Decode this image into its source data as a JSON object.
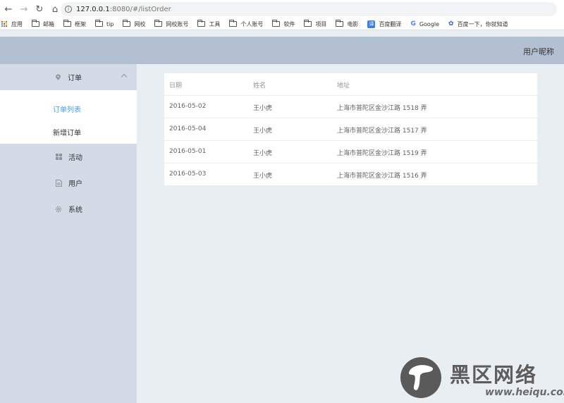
{
  "browser": {
    "url_host": "127.0.0.1",
    "url_rest": ":8080/#/listOrder",
    "bookmarks": [
      {
        "label": "应用",
        "icon": "apps-icon"
      },
      {
        "label": "邮箱",
        "icon": "folder-icon"
      },
      {
        "label": "框架",
        "icon": "folder-icon"
      },
      {
        "label": "tip",
        "icon": "folder-icon"
      },
      {
        "label": "网校",
        "icon": "folder-icon"
      },
      {
        "label": "网校账号",
        "icon": "folder-icon"
      },
      {
        "label": "工具",
        "icon": "folder-icon"
      },
      {
        "label": "个人账号",
        "icon": "folder-icon"
      },
      {
        "label": "软件",
        "icon": "folder-icon"
      },
      {
        "label": "项目",
        "icon": "folder-icon"
      },
      {
        "label": "电影",
        "icon": "folder-icon"
      },
      {
        "label": "百度翻译",
        "icon": "fanyi-icon"
      },
      {
        "label": "Google",
        "icon": "google-icon"
      },
      {
        "label": "百度一下，你就知道",
        "icon": "baidu-icon"
      }
    ]
  },
  "header": {
    "user_name": "用户昵称"
  },
  "sidebar": {
    "order_menu": {
      "label": "订单",
      "icon": "location-pin-icon",
      "items": [
        {
          "label": "订单列表",
          "active": true
        },
        {
          "label": "新增订单",
          "active": false
        }
      ]
    },
    "items": [
      {
        "label": "活动",
        "icon": "grid-icon"
      },
      {
        "label": "用户",
        "icon": "document-icon"
      },
      {
        "label": "系统",
        "icon": "gear-icon"
      }
    ]
  },
  "table": {
    "columns": [
      "日期",
      "姓名",
      "地址"
    ],
    "rows": [
      {
        "date": "2016-05-02",
        "name": "王小虎",
        "address": "上海市普陀区金沙江路 1518 弄"
      },
      {
        "date": "2016-05-04",
        "name": "王小虎",
        "address": "上海市普陀区金沙江路 1517 弄"
      },
      {
        "date": "2016-05-01",
        "name": "王小虎",
        "address": "上海市普陀区金沙江路 1519 弄"
      },
      {
        "date": "2016-05-03",
        "name": "王小虎",
        "address": "上海市普陀区金沙江路 1516 弄"
      }
    ]
  },
  "watermark": {
    "title": "黑区网络",
    "url": "www.heiqu.com"
  },
  "colors": {
    "active_menu": "#409eff",
    "header_bg": "#b3c0d1",
    "sidebar_bg": "#d3dce6",
    "main_bg": "#e9eef3"
  }
}
